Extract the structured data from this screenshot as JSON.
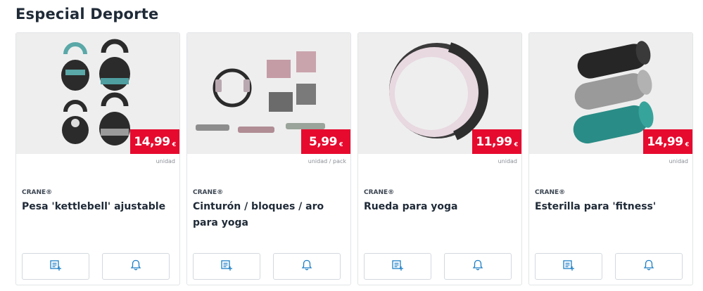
{
  "section": {
    "title": "Especial Deporte"
  },
  "colors": {
    "accent": "#e60a2e",
    "icon": "#1e7fc6",
    "image_bg": "#eeeeee"
  },
  "products": [
    {
      "brand": "CRANE®",
      "name": "Pesa 'kettlebell' ajustable",
      "price": "14,99",
      "currency": "€",
      "unit": "unidad",
      "image": "kettlebells",
      "buttons": [
        "list-add-icon",
        "bell-icon"
      ]
    },
    {
      "brand": "CRANE®",
      "name": "Cinturón / bloques / aro para yoga",
      "price": "5,99",
      "currency": "€",
      "unit": "unidad / pack",
      "image": "yoga-accessories",
      "buttons": [
        "list-add-icon",
        "bell-icon"
      ]
    },
    {
      "brand": "CRANE®",
      "name": "Rueda para yoga",
      "price": "11,99",
      "currency": "€",
      "unit": "unidad",
      "image": "yoga-wheel",
      "buttons": [
        "list-add-icon",
        "bell-icon"
      ]
    },
    {
      "brand": "CRANE®",
      "name": "Esterilla para 'fitness'",
      "price": "14,99",
      "currency": "€",
      "unit": "unidad",
      "image": "fitness-mats",
      "buttons": [
        "list-add-icon",
        "bell-icon"
      ]
    }
  ]
}
